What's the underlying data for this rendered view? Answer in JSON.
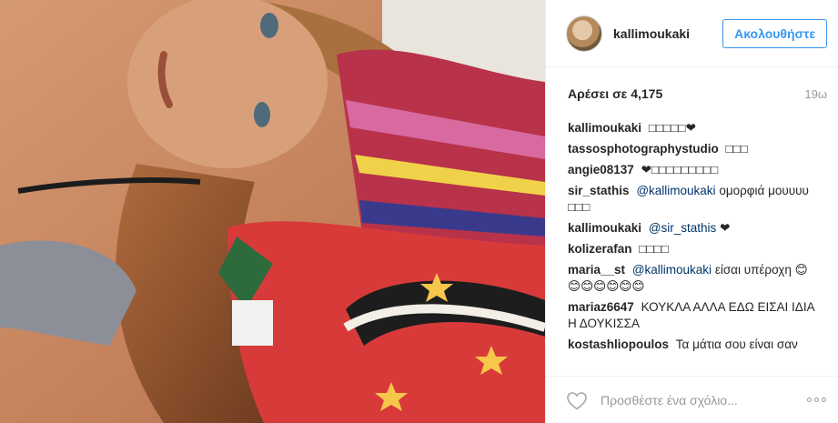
{
  "post": {
    "username": "kallimoukaki",
    "follow_label": "Ακολουθήστε",
    "likes": "Αρέσει σε 4,175",
    "time": "19ω"
  },
  "comments": [
    {
      "author": "kallimoukaki",
      "mention": "",
      "text": "□□□□□❤"
    },
    {
      "author": "tassosphotographystudio",
      "mention": "",
      "text": "□□□"
    },
    {
      "author": "angie08137",
      "mention": "",
      "text": "❤□□□□□□□□□"
    },
    {
      "author": "sir_stathis",
      "mention": "@kallimoukaki",
      "text": "ομορφιά μουυυυ □□□"
    },
    {
      "author": "kallimoukaki",
      "mention": "@sir_stathis",
      "text": "❤"
    },
    {
      "author": "kolizerafan",
      "mention": "",
      "text": "□□□□"
    },
    {
      "author": "maria__st",
      "mention": "@kallimoukaki",
      "text": "είσαι υπέροχη 😊😊😊😊😊😊😊"
    },
    {
      "author": "mariaz6647",
      "mention": "",
      "text": "ΚΟΥΚΛΑ ΑΛΛΑ ΕΔΩ ΕΙΣΑΙ ΙΔΙΑ Η ΔΟΥΚΙΣΣΑ"
    },
    {
      "author": "kostashliopoulos",
      "mention": "",
      "text": "Τα μάτια σου είναι σαν"
    }
  ],
  "add_comment": {
    "placeholder": "Προσθέστε ένα σχόλιο..."
  },
  "icons": {
    "like": "heart-outline-icon",
    "more": "more-options-icon"
  }
}
